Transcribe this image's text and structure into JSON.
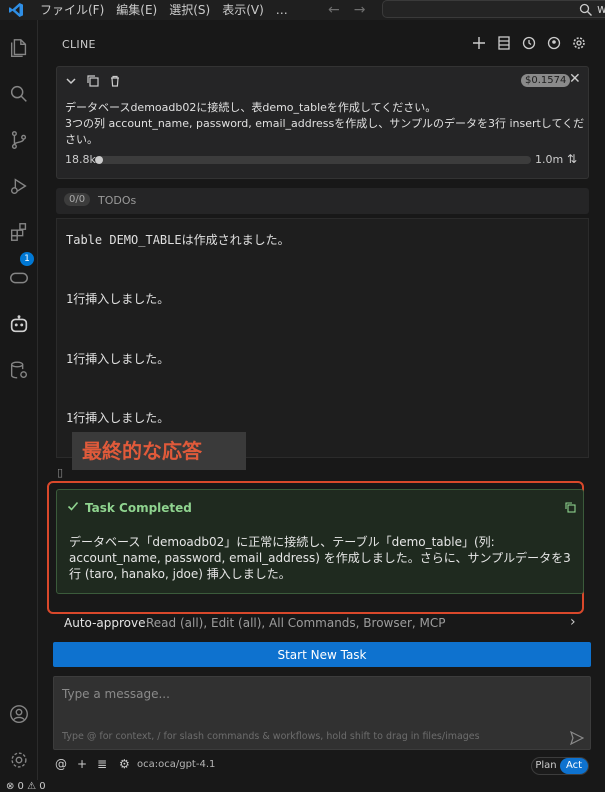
{
  "titlebar": {
    "menu": [
      "ファイル(F)",
      "編集(E)",
      "選択(S)",
      "表示(V)",
      "…"
    ],
    "search_partial": "w"
  },
  "activity": {
    "extensions_badge": "1"
  },
  "panel": {
    "title": "CLINE"
  },
  "task": {
    "cost": "$0.1574",
    "text_line1": "データベースdemoadb02に接続し、表demo_tableを作成してください。",
    "text_line2": "3つの列 account_name, password, email_addressを作成し、サンプルのデータを3行 insertしてくだ",
    "text_line3": "さい。",
    "context_used": "18.8k",
    "context_max": "1.0m",
    "context_fraction": 0.019
  },
  "todos": {
    "count": "0/0",
    "label": "TODOs"
  },
  "output": {
    "lines": [
      "Table DEMO_TABLEは作成されました。",
      "1行挿入しました。",
      "1行挿入しました。",
      "1行挿入しました。"
    ]
  },
  "annotation": {
    "label": "最終的な応答",
    "color": "#d9482b"
  },
  "completion": {
    "title": "Task Completed",
    "body": "データベース「demoadb02」に正常に接続し、テーブル「demo_table」(列: account_name, password, email_address) を作成しました。さらに、サンプルデータを3行 (taro, hanako, jdoe) 挿入しました。"
  },
  "auto_approve": {
    "label": "Auto-approve:",
    "value": "Read (all), Edit (all), All Commands, Browser, MCP"
  },
  "start_button": {
    "label": "Start New Task"
  },
  "message": {
    "placeholder": "Type a message...",
    "hint": "Type @ for context, / for slash commands & workflows, hold shift to drag in files/images"
  },
  "footer": {
    "model": "oca:oca/gpt-4.1",
    "plan_label": "Plan",
    "act_label": "Act"
  },
  "statusbar": {
    "text": "⊗ 0 ⚠ 0"
  },
  "colors": {
    "accent": "#0e72cf",
    "success": "#8fd38f",
    "highlight": "#d9482b"
  }
}
